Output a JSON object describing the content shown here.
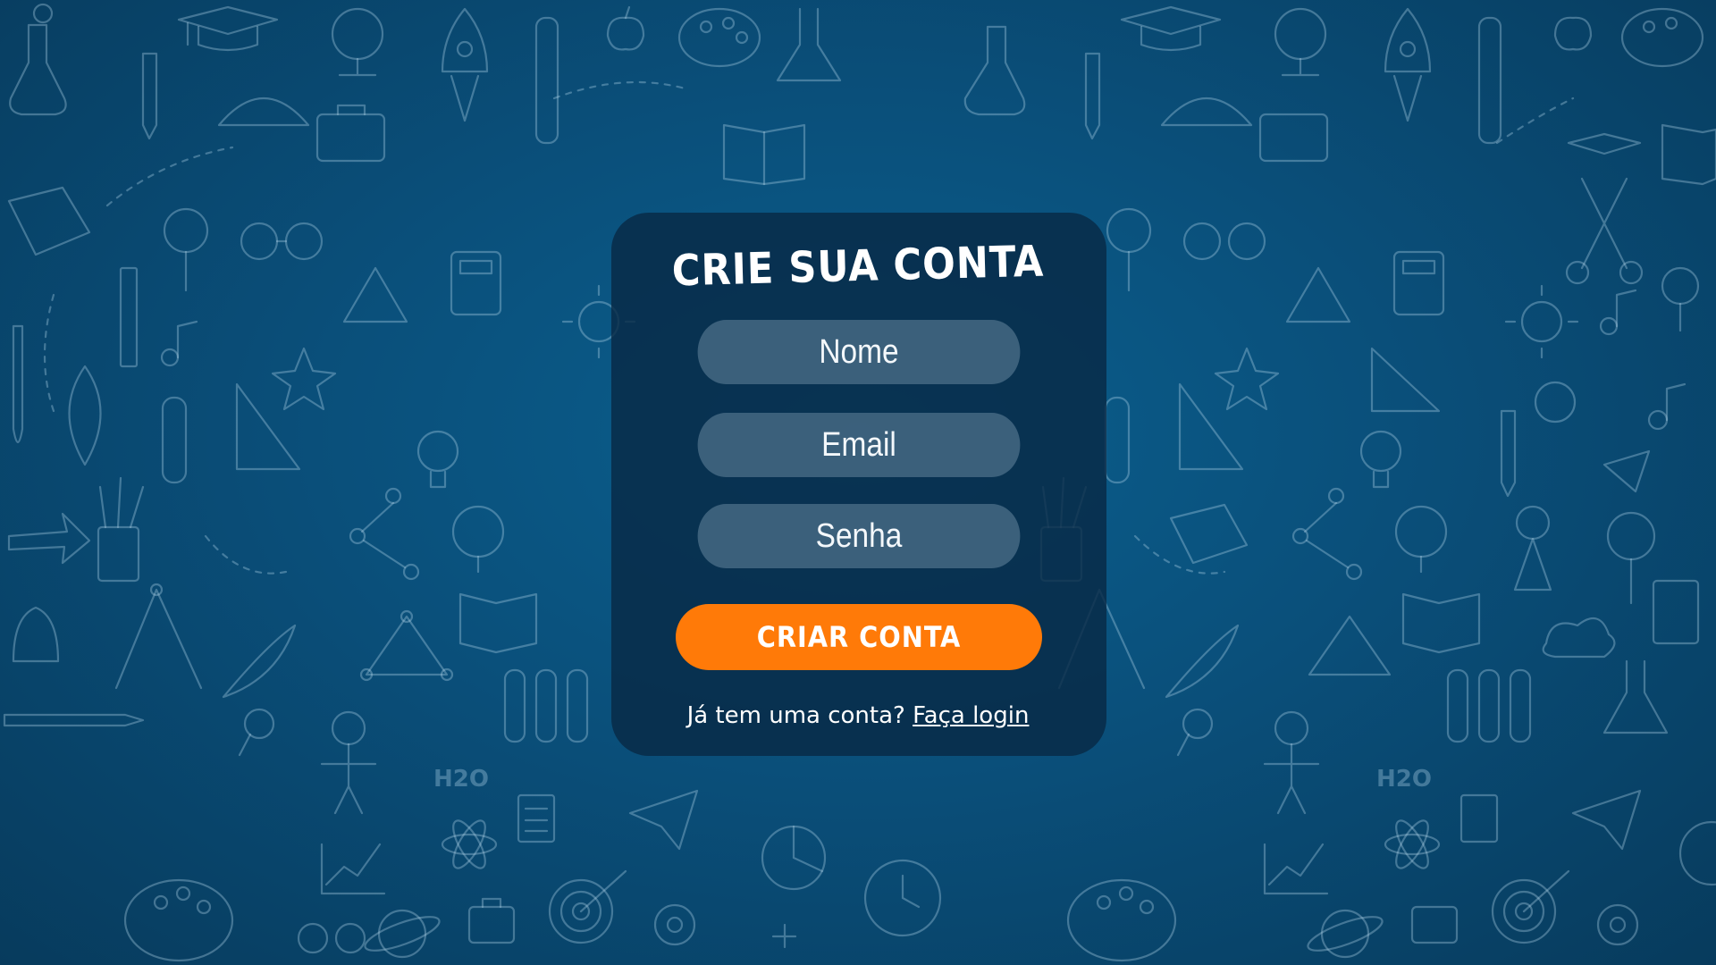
{
  "form": {
    "title": "CRIE SUA CONTA",
    "name_placeholder": "Nome",
    "email_placeholder": "Email",
    "password_placeholder": "Senha",
    "submit_label": "CRIAR CONTA",
    "login_prompt": "Já tem uma conta?",
    "login_link": "Faça login"
  },
  "colors": {
    "background": "#0a4f7a",
    "card": "#082a46",
    "field": "#82a0b4",
    "button": "#ff7a08",
    "text": "#ffffff"
  },
  "icons": {
    "background_decorations": [
      "flask-icon",
      "graduation-cap-icon",
      "rocket-icon",
      "apple-icon",
      "palette-icon",
      "globe-icon",
      "pencil-icon",
      "book-icon",
      "calculator-icon",
      "magnifier-icon",
      "glasses-icon",
      "lightbulb-icon",
      "atom-icon",
      "paper-plane-icon",
      "test-tubes-icon",
      "alarm-clock-icon",
      "target-icon",
      "gear-icon",
      "planet-icon",
      "music-note-icon"
    ]
  }
}
